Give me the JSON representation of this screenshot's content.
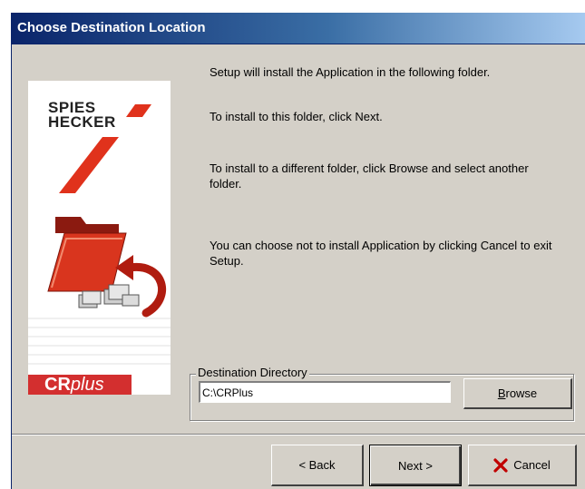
{
  "window": {
    "title": "Choose Destination Location"
  },
  "branding": {
    "logo_line1": "SPIES",
    "logo_line2": "HECKER",
    "product_cr": "CR",
    "product_plus": "plus"
  },
  "content": {
    "line1": "Setup will install the Application in the following folder.",
    "line2": "To install to this folder, click Next.",
    "line3": "To install to a different folder, click Browse and select another folder.",
    "line4": "You can choose not to install Application by clicking Cancel to exit Setup."
  },
  "destination": {
    "group_label": "Destination Directory",
    "path_value": "C:\\CRPlus",
    "browse_label_first": "B",
    "browse_label_rest": "rowse"
  },
  "buttons": {
    "back": "< Back",
    "next": "Next >",
    "cancel": "Cancel"
  },
  "colors": {
    "title_bar": "#0a246a",
    "face": "#d4d0c8",
    "brand_red": "#d32f2f"
  },
  "icons": [
    "folder-icon",
    "return-arrow-icon",
    "documents-icon",
    "red-x-icon"
  ]
}
